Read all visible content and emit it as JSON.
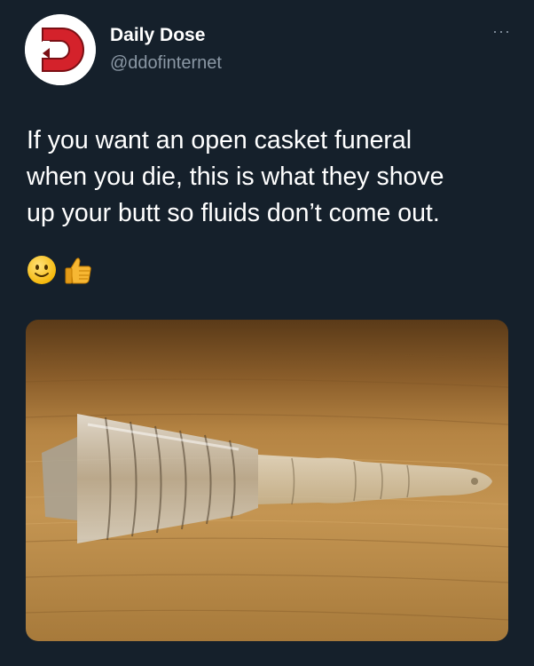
{
  "tweet": {
    "author_name": "Daily Dose",
    "author_handle": "@ddofinternet",
    "text": "If you want an open casket funeral\nwhen you die, this is what they shove\nup your butt so fluids don’t come out.",
    "emojis": [
      "slightly-smiling-face-emoji",
      "thumbs-up-emoji"
    ],
    "more_label": "···",
    "media_icon": "photo"
  },
  "colors": {
    "background": "#15202b",
    "text": "#ffffff",
    "secondary_text": "#8b98a5",
    "avatar_red": "#d4222b"
  }
}
